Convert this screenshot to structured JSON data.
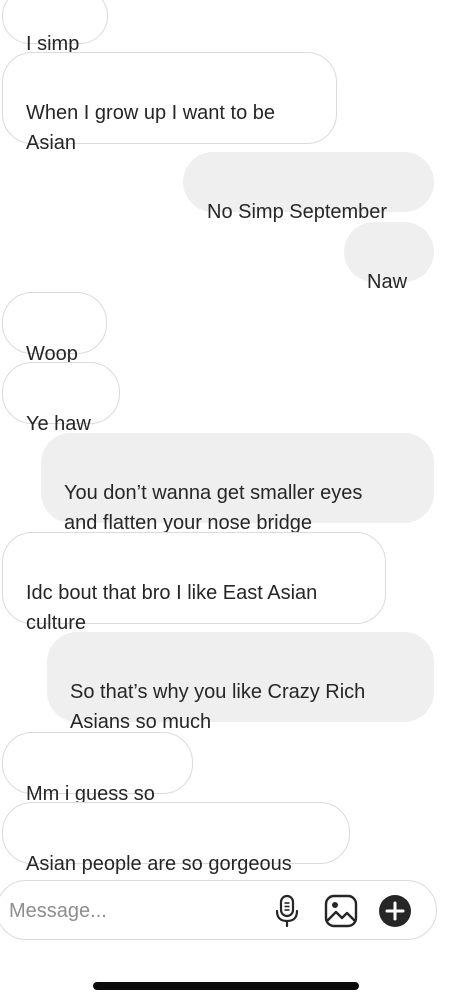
{
  "messages": [
    {
      "sender": "other",
      "text": "I simp"
    },
    {
      "sender": "other",
      "text": "When I grow up I want to be\nAsian"
    },
    {
      "sender": "me",
      "text": "No Simp September"
    },
    {
      "sender": "me",
      "text": "Naw"
    },
    {
      "sender": "other",
      "text": "Woop"
    },
    {
      "sender": "other",
      "text": "Ye haw"
    },
    {
      "sender": "me",
      "text": "You don’t wanna get smaller eyes\nand flatten your nose bridge"
    },
    {
      "sender": "other",
      "text": "Idc bout that bro I like East Asian\nculture"
    },
    {
      "sender": "me",
      "text": "So that’s why you like Crazy Rich\nAsians so much"
    },
    {
      "sender": "other",
      "text": "Mm i guess so"
    },
    {
      "sender": "other",
      "text": "Asian people are so gorgeous"
    }
  ],
  "composer": {
    "placeholder": "Message...",
    "value": ""
  },
  "icons": {
    "voice": "microphone-icon",
    "gallery": "image-icon",
    "more": "plus-circle-icon"
  },
  "colors": {
    "sent_bubble": "#efefef",
    "received_border": "#dbdbdb",
    "text": "#262626",
    "placeholder": "#8e8e8e"
  }
}
